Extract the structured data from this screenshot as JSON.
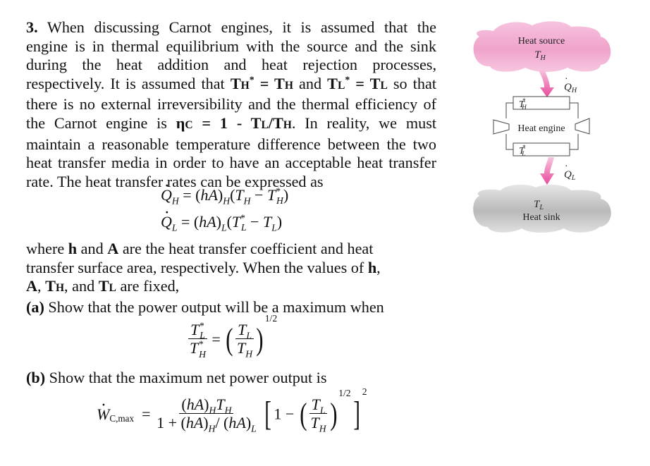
{
  "problem": {
    "number": "3.",
    "intro_lines": [
      "When discussing Carnot engines, it is assumed that the",
      "engine is in thermal equilibrium with the source and the sink",
      "during the heat addition and heat rejection processes,"
    ],
    "line4_pre": "respectively. It is assumed that ",
    "line4_mid": " and ",
    "line4_post": " so that",
    "line5": "there is no external irreversibility and the thermal efficiency of",
    "line6_pre": "the Carnot engine is ",
    "line6_eff": "η",
    "line6_eff_sub": "C",
    "line6_eq": " = 1 - T",
    "line6_post": ". In reality, we must",
    "line7": "maintain a reasonable temperature difference between the two",
    "line8": "heat transfer media in order to have an acceptable heat transfer",
    "line9": "rate. The heat transfer rates can be expressed as",
    "where_line1_a": "where ",
    "where_h": "h",
    "where_line1_b": " and ",
    "where_A": "A",
    "where_line1_c": " are the heat transfer coefficient and heat",
    "where_line2": "transfer surface area, respectively. When the values of ",
    "where_line2_h": "h",
    "where_line3_A": "A",
    "where_line3_rest": " are fixed,",
    "part_a_label": "(a)",
    "part_a_text": " Show that the power output will be a maximum when",
    "part_b_label": "(b)",
    "part_b_text": " Show that the maximum net power output is"
  },
  "equations": {
    "qh": "Q̇_H = (hA)_H(T_H − T*_H)",
    "ql": "Q̇_L = (hA)_L(T*_L − T_L)",
    "part_a": "T*_L / T*_H = (T_L / T_H)^(1/2)",
    "part_b": "Ẇ_C,max = (hA)_H T_H / (1 + (hA)_H/(hA)_L) [1 − (T_L/T_H)^(1/2)]^2",
    "exponent_half": "1/2",
    "exponent_two": "2",
    "wc_sub": "C,max",
    "one": "1",
    "one_plus": "1 + "
  },
  "diagram": {
    "source_label": "Heat source",
    "source_temp": "T",
    "source_temp_sub": "H",
    "qh_label": "Q",
    "qh_sub": "H",
    "engine_label": "Heat engine",
    "th_star": "T",
    "th_star_sub": "H",
    "tl_star": "T",
    "tl_star_sub": "L",
    "ql_label": "Q",
    "ql_sub": "L",
    "sink_temp": "T",
    "sink_temp_sub": "L",
    "sink_label": "Heat sink",
    "colors": {
      "source_pink": "#f3a9d0",
      "arrow_magenta": "#e8479a",
      "sink_gray": "#bdbdbd"
    }
  }
}
